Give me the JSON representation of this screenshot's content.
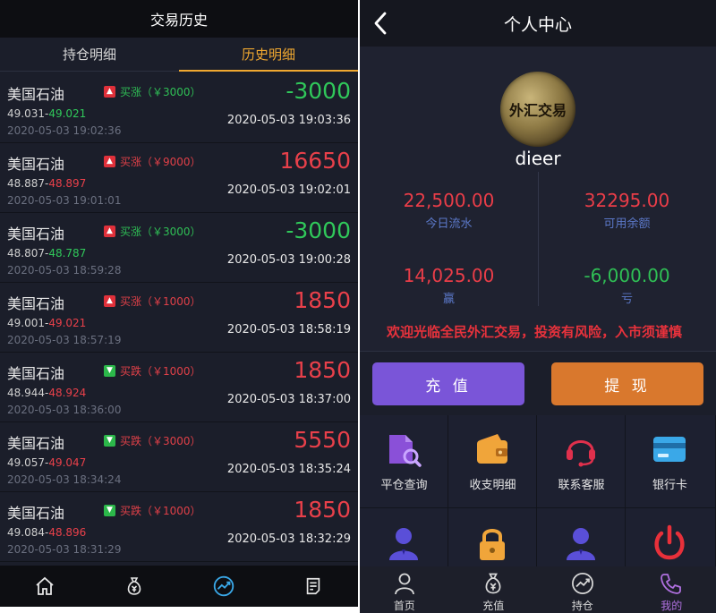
{
  "left": {
    "title": "交易历史",
    "tabs": [
      {
        "label": "持仓明细",
        "active": false
      },
      {
        "label": "历史明细",
        "active": true
      }
    ],
    "orders": [
      {
        "name": "美国石油",
        "direction": "up",
        "direction_text": "买涨（￥3000）",
        "price_from": "49.031-",
        "price_to": "49.021",
        "price_to_color": "green",
        "open_time": "2020-05-03 19:02:36",
        "pnl": "-3000",
        "pnl_color": "green",
        "close_time": "2020-05-03 19:03:36"
      },
      {
        "name": "美国石油",
        "direction": "up",
        "direction_text": "买涨（￥9000）",
        "price_from": "48.887-",
        "price_to": "48.897",
        "price_to_color": "red",
        "open_time": "2020-05-03 19:01:01",
        "pnl": "16650",
        "pnl_color": "red",
        "close_time": "2020-05-03 19:02:01"
      },
      {
        "name": "美国石油",
        "direction": "up",
        "direction_text": "买涨（￥3000）",
        "price_from": "48.807-",
        "price_to": "48.787",
        "price_to_color": "green",
        "open_time": "2020-05-03 18:59:28",
        "pnl": "-3000",
        "pnl_color": "green",
        "close_time": "2020-05-03 19:00:28"
      },
      {
        "name": "美国石油",
        "direction": "up",
        "direction_text": "买涨（￥1000）",
        "price_from": "49.001-",
        "price_to": "49.021",
        "price_to_color": "red",
        "open_time": "2020-05-03 18:57:19",
        "pnl": "1850",
        "pnl_color": "red",
        "close_time": "2020-05-03 18:58:19"
      },
      {
        "name": "美国石油",
        "direction": "down",
        "direction_text": "买跌（￥1000）",
        "price_from": "48.944-",
        "price_to": "48.924",
        "price_to_color": "red",
        "open_time": "2020-05-03 18:36:00",
        "pnl": "1850",
        "pnl_color": "red",
        "close_time": "2020-05-03 18:37:00"
      },
      {
        "name": "美国石油",
        "direction": "down",
        "direction_text": "买跌（￥3000）",
        "price_from": "49.057-",
        "price_to": "49.047",
        "price_to_color": "red",
        "open_time": "2020-05-03 18:34:24",
        "pnl": "5550",
        "pnl_color": "red",
        "close_time": "2020-05-03 18:35:24"
      },
      {
        "name": "美国石油",
        "direction": "down",
        "direction_text": "买跌（￥1000）",
        "price_from": "49.084-",
        "price_to": "48.896",
        "price_to_color": "red",
        "open_time": "2020-05-03 18:31:29",
        "pnl": "1850",
        "pnl_color": "red",
        "close_time": "2020-05-03 18:32:29"
      }
    ],
    "nav_icons": [
      "home-icon",
      "money-bag-icon",
      "trend-chart-icon",
      "document-icon"
    ],
    "active_nav": "trend-chart-icon"
  },
  "right": {
    "title": "个人中心",
    "avatar_text": "外汇交易",
    "username": "dieer",
    "stats": [
      {
        "value": "22,500.00",
        "label": "今日流水",
        "color": "red"
      },
      {
        "value": "32295.00",
        "label": "可用余额",
        "color": "red"
      },
      {
        "value": "14,025.00",
        "label": "赢",
        "color": "red"
      },
      {
        "value": "-6,000.00",
        "label": "亏",
        "color": "green"
      }
    ],
    "marquee": "欢迎光临全民外汇交易，投资有风险，入市须谨慎",
    "recharge_label": "充 值",
    "withdraw_label": "提 现",
    "grid": [
      {
        "label": "平仓查询",
        "icon": "file-search-icon"
      },
      {
        "label": "收支明细",
        "icon": "wallet-icon"
      },
      {
        "label": "联系客服",
        "icon": "headset-icon"
      },
      {
        "label": "银行卡",
        "icon": "bank-card-icon"
      },
      {
        "label": "",
        "icon": "user-icon"
      },
      {
        "label": "",
        "icon": "lock-icon"
      },
      {
        "label": "",
        "icon": "user-icon"
      },
      {
        "label": "",
        "icon": "power-icon"
      }
    ],
    "nav": [
      {
        "label": "首页",
        "icon": "user-outline-icon",
        "active": false
      },
      {
        "label": "充值",
        "icon": "money-bag-icon",
        "active": false
      },
      {
        "label": "持仓",
        "icon": "trend-chart-icon",
        "active": false
      },
      {
        "label": "我的",
        "icon": "phone-icon",
        "active": true
      }
    ],
    "colors": {
      "accent_purple": "#7a55d8",
      "accent_orange": "#d9782d",
      "profit_red": "#ea3d48",
      "loss_green": "#2fbf55"
    }
  }
}
